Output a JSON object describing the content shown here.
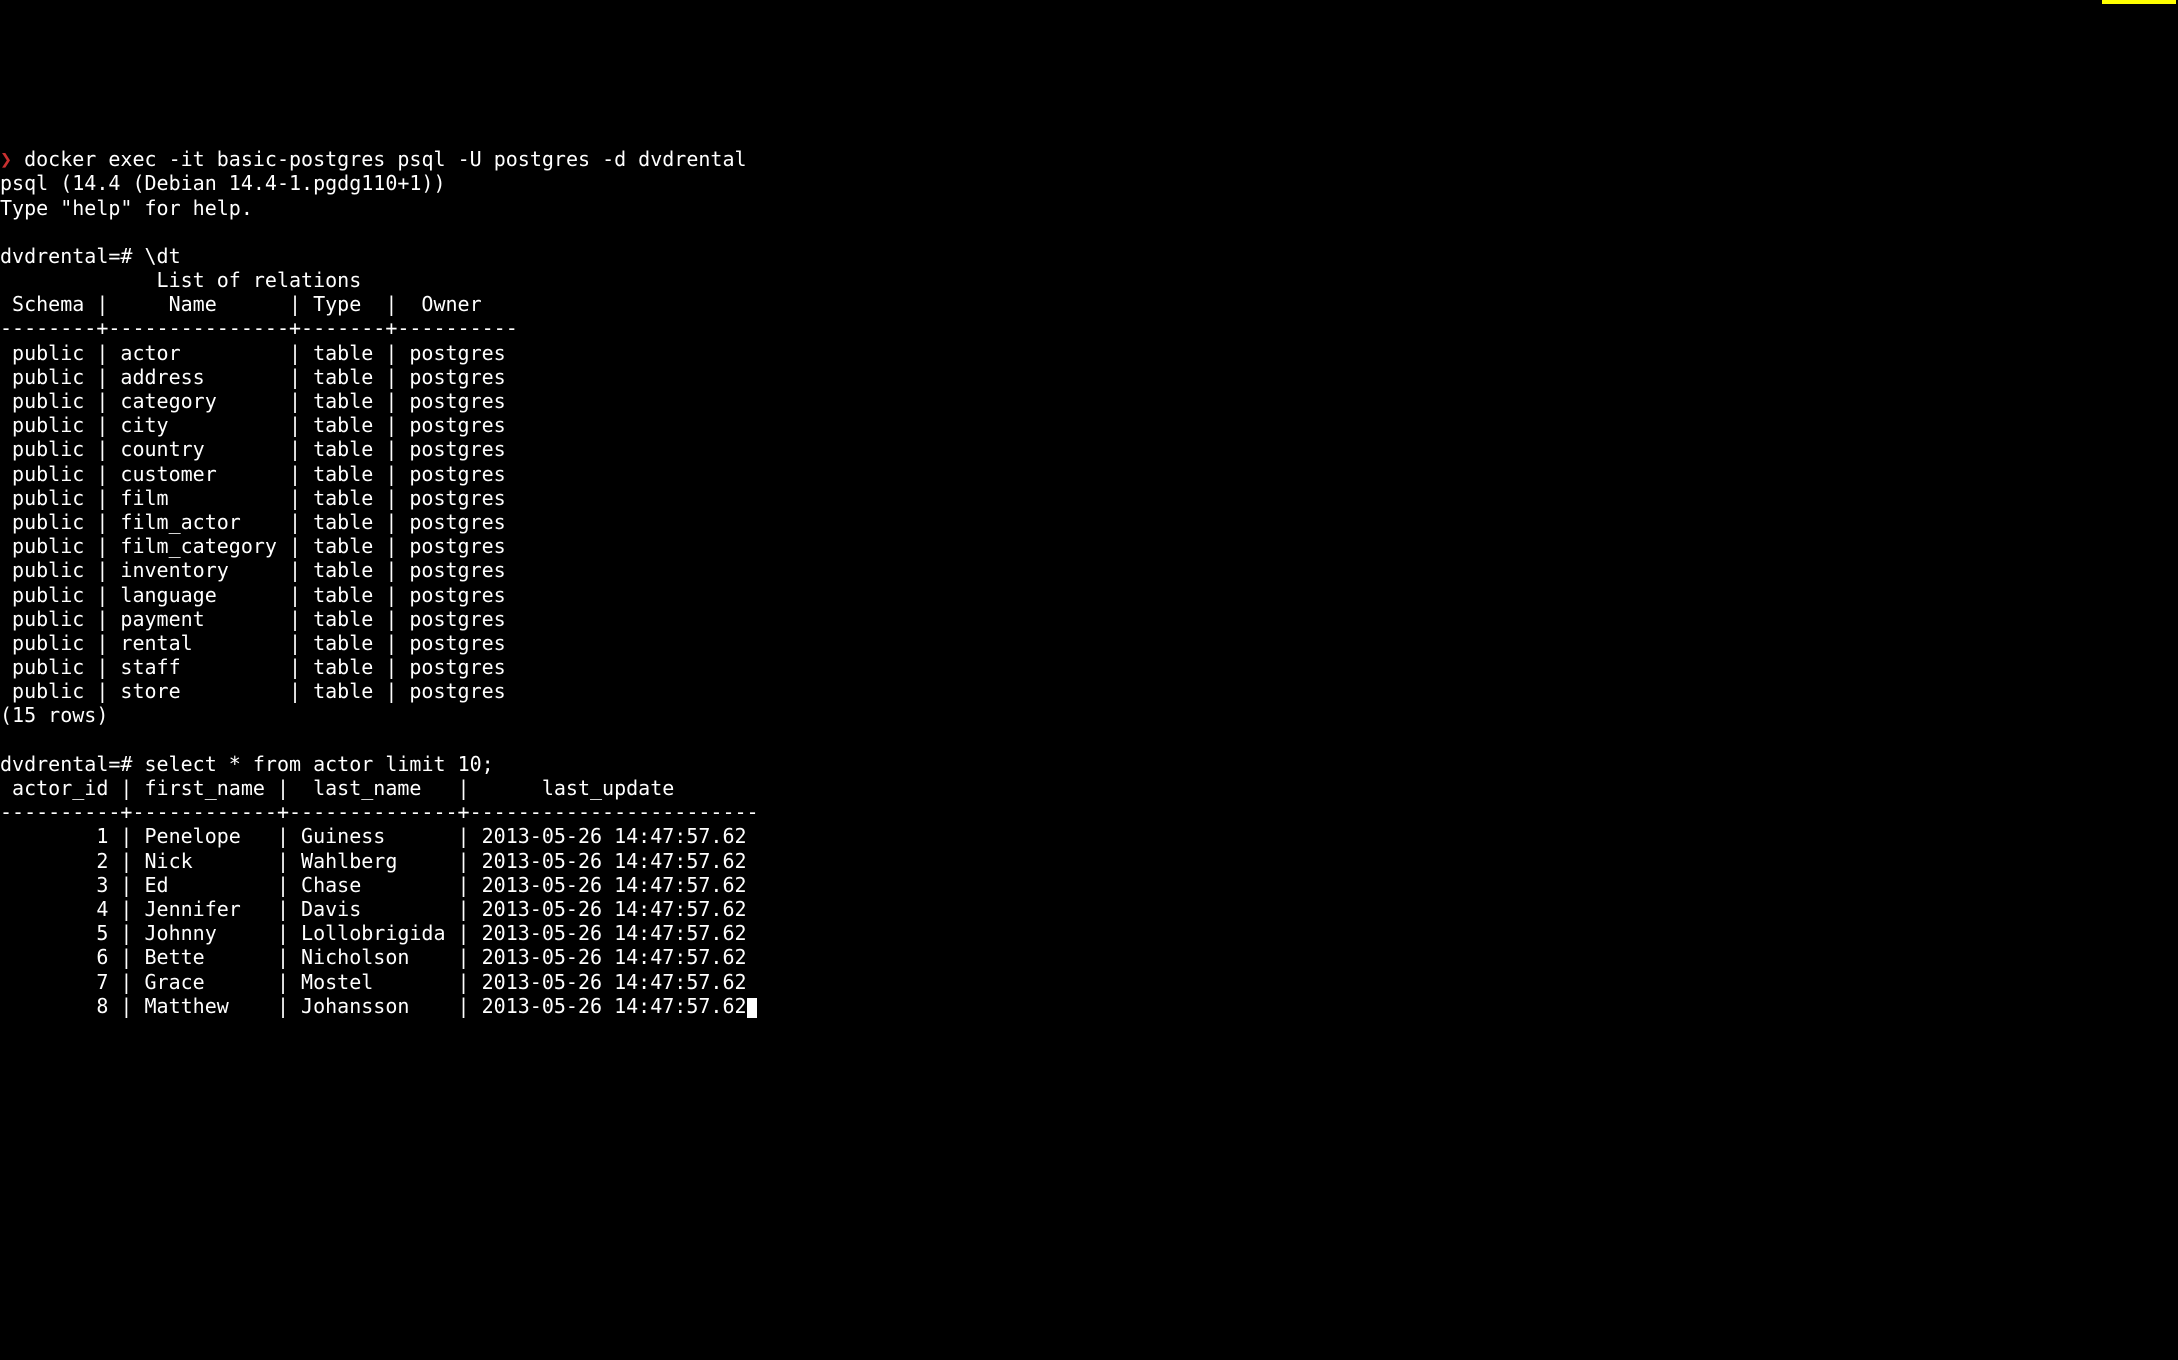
{
  "terminal": {
    "prompt_symbol": "❯",
    "command": "docker exec -it basic-postgres psql -U postgres -d dvdrental",
    "psql_version": "psql (14.4 (Debian 14.4-1.pgdg110+1))",
    "help_hint": "Type \"help\" for help.",
    "db_prompt": "dvdrental=#",
    "cmd_dt": "\\dt",
    "relations_title": "List of relations",
    "relations_header": " Schema |     Name      | Type  |  Owner",
    "relations_divider": "--------+---------------+-------+----------",
    "relations_rows": [
      " public | actor         | table | postgres",
      " public | address       | table | postgres",
      " public | category      | table | postgres",
      " public | city          | table | postgres",
      " public | country       | table | postgres",
      " public | customer      | table | postgres",
      " public | film          | table | postgres",
      " public | film_actor    | table | postgres",
      " public | film_category | table | postgres",
      " public | inventory     | table | postgres",
      " public | language      | table | postgres",
      " public | payment       | table | postgres",
      " public | rental        | table | postgres",
      " public | staff         | table | postgres",
      " public | store         | table | postgres"
    ],
    "relations_count": "(15 rows)",
    "cmd_select": "select * from actor limit 10;",
    "actor_header": " actor_id | first_name |  last_name   |      last_update",
    "actor_divider": "----------+------------+--------------+------------------------",
    "actor_rows": [
      "        1 | Penelope   | Guiness      | 2013-05-26 14:47:57.62",
      "        2 | Nick       | Wahlberg     | 2013-05-26 14:47:57.62",
      "        3 | Ed         | Chase        | 2013-05-26 14:47:57.62",
      "        4 | Jennifer   | Davis        | 2013-05-26 14:47:57.62",
      "        5 | Johnny     | Lollobrigida | 2013-05-26 14:47:57.62",
      "        6 | Bette      | Nicholson    | 2013-05-26 14:47:57.62",
      "        7 | Grace      | Mostel       | 2013-05-26 14:47:57.62",
      "        8 | Matthew    | Johansson    | 2013-05-26 14:47:57.62"
    ]
  }
}
